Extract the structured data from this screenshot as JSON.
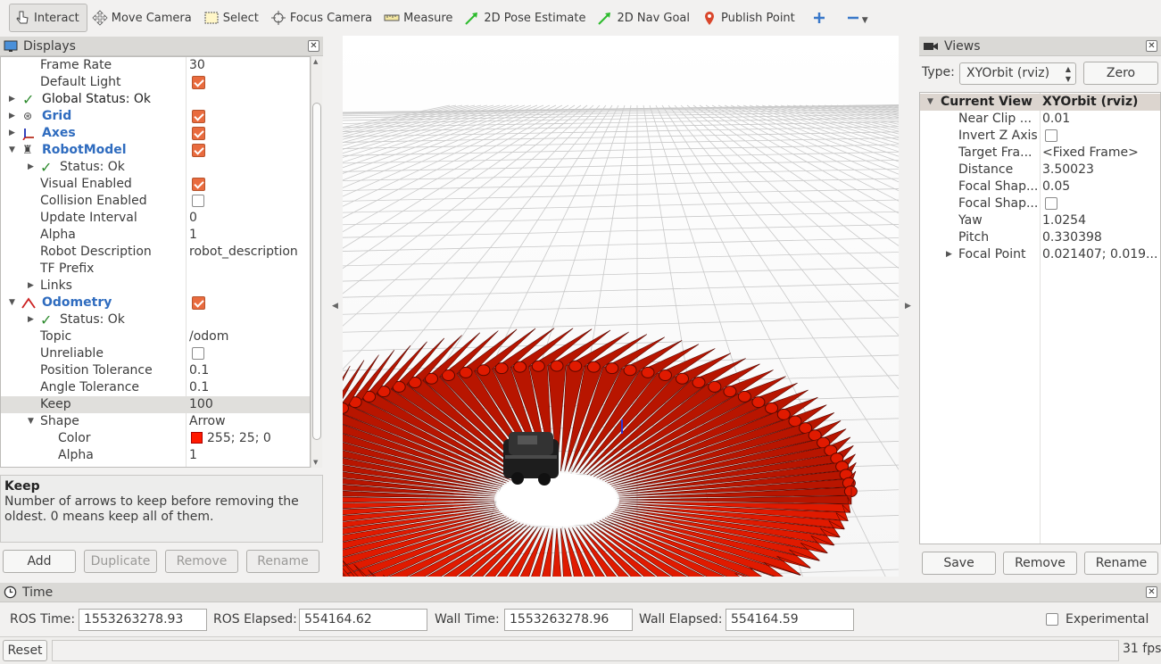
{
  "toolbar": {
    "tools": [
      {
        "label": "Interact",
        "icon": "hand-pointer-icon",
        "active": true
      },
      {
        "label": "Move Camera",
        "icon": "move-camera-icon"
      },
      {
        "label": "Select",
        "icon": "select-rect-icon"
      },
      {
        "label": "Focus Camera",
        "icon": "focus-target-icon"
      },
      {
        "label": "Measure",
        "icon": "ruler-icon"
      },
      {
        "label": "2D Pose Estimate",
        "icon": "green-arrow-icon"
      },
      {
        "label": "2D Nav Goal",
        "icon": "green-arrow-icon"
      },
      {
        "label": "Publish Point",
        "icon": "map-pin-icon"
      }
    ]
  },
  "displays": {
    "title": "Displays",
    "rows": [
      {
        "name": "Frame Rate",
        "value": "30"
      },
      {
        "name": "Default Light",
        "value": ""
      },
      {
        "name": "Global Status: Ok",
        "value": ""
      },
      {
        "name": "Grid",
        "value": ""
      },
      {
        "name": "Axes",
        "value": ""
      },
      {
        "name": "RobotModel",
        "value": ""
      },
      {
        "name": "Status: Ok",
        "value": ""
      },
      {
        "name": "Visual Enabled",
        "value": ""
      },
      {
        "name": "Collision Enabled",
        "value": ""
      },
      {
        "name": "Update Interval",
        "value": "0"
      },
      {
        "name": "Alpha",
        "value": "1"
      },
      {
        "name": "Robot Description",
        "value": "robot_description"
      },
      {
        "name": "TF Prefix",
        "value": ""
      },
      {
        "name": "Links",
        "value": ""
      },
      {
        "name": "Odometry",
        "value": ""
      },
      {
        "name": "Status: Ok",
        "value": ""
      },
      {
        "name": "Topic",
        "value": "/odom"
      },
      {
        "name": "Unreliable",
        "value": ""
      },
      {
        "name": "Position Tolerance",
        "value": "0.1"
      },
      {
        "name": "Angle Tolerance",
        "value": "0.1"
      },
      {
        "name": "Keep",
        "value": "100"
      },
      {
        "name": "Shape",
        "value": "Arrow"
      },
      {
        "name": "Color",
        "value": "255; 25; 0"
      },
      {
        "name": "Alpha",
        "value": "1"
      }
    ],
    "description_title": "Keep",
    "description_text": "Number of arrows to keep before removing the oldest. 0 means keep all of them.",
    "buttons": {
      "add": "Add",
      "duplicate": "Duplicate",
      "remove": "Remove",
      "rename": "Rename"
    }
  },
  "views": {
    "title": "Views",
    "type_label": "Type:",
    "type_value": "XYOrbit (rviz)",
    "zero_label": "Zero",
    "rows": [
      {
        "name": "Current View",
        "value": "XYOrbit (rviz)"
      },
      {
        "name": "Near Clip ...",
        "value": "0.01"
      },
      {
        "name": "Invert Z Axis",
        "value": ""
      },
      {
        "name": "Target Fra...",
        "value": "<Fixed Frame>"
      },
      {
        "name": "Distance",
        "value": "3.50023"
      },
      {
        "name": "Focal Shap...",
        "value": "0.05"
      },
      {
        "name": "Focal Shap...",
        "value": ""
      },
      {
        "name": "Yaw",
        "value": "1.0254"
      },
      {
        "name": "Pitch",
        "value": "0.330398"
      },
      {
        "name": "Focal Point",
        "value": "0.021407; 0.019..."
      }
    ],
    "buttons": {
      "save": "Save",
      "remove": "Remove",
      "rename": "Rename"
    }
  },
  "time": {
    "title": "Time",
    "ros_time_label": "ROS Time:",
    "ros_time": "1553263278.93",
    "ros_elapsed_label": "ROS Elapsed:",
    "ros_elapsed": "554164.62",
    "wall_time_label": "Wall Time:",
    "wall_time": "1553263278.96",
    "wall_elapsed_label": "Wall Elapsed:",
    "wall_elapsed": "554164.59",
    "experimental_label": "Experimental"
  },
  "status": {
    "reset_label": "Reset",
    "fps": "31 fps"
  },
  "colors": {
    "checkbox": "#e96b3e",
    "link_blue": "#2f6cbf",
    "arrow_red": "#ff1900"
  }
}
